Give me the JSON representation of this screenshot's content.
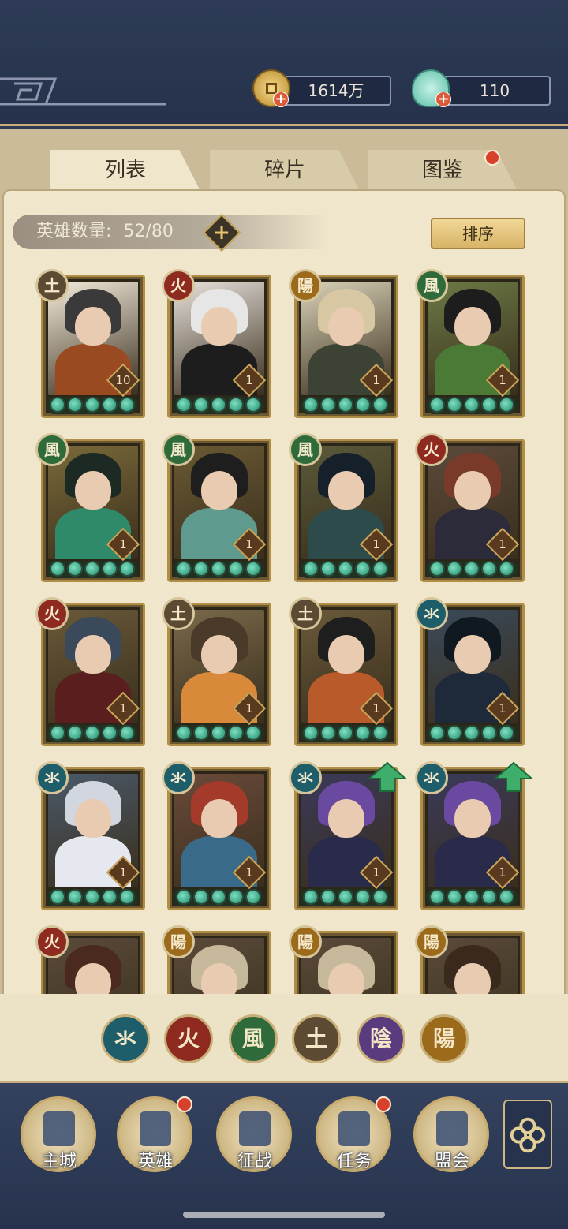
{
  "currency": {
    "coins": "1614万",
    "jade": "110"
  },
  "tabs": [
    {
      "label": "列表",
      "active": true
    },
    {
      "label": "碎片",
      "active": false
    },
    {
      "label": "图鉴",
      "active": false
    }
  ],
  "hero_count": {
    "label": "英雄数量:",
    "value": "52/80"
  },
  "sort_label": "排序",
  "element_glyphs": {
    "water": "氺",
    "fire": "火",
    "wind": "風",
    "earth": "土",
    "yin": "陰",
    "yang": "陽"
  },
  "colors": {
    "water": "#1e5e6a",
    "fire": "#8e2a20",
    "wind": "#2e6a3a",
    "earth": "#5c4a32",
    "yin": "#5a3b7e",
    "yang": "#9b6a1a"
  },
  "heroes": [
    {
      "element": "earth",
      "glyph": "土",
      "level": "10",
      "upgrade": false
    },
    {
      "element": "fire",
      "glyph": "火",
      "level": "1",
      "upgrade": false
    },
    {
      "element": "yang",
      "glyph": "陽",
      "level": "1",
      "upgrade": false
    },
    {
      "element": "wind",
      "glyph": "風",
      "level": "1",
      "upgrade": false
    },
    {
      "element": "wind",
      "glyph": "風",
      "level": "1",
      "upgrade": false
    },
    {
      "element": "wind",
      "glyph": "風",
      "level": "1",
      "upgrade": false
    },
    {
      "element": "wind",
      "glyph": "風",
      "level": "1",
      "upgrade": false
    },
    {
      "element": "fire",
      "glyph": "火",
      "level": "1",
      "upgrade": false
    },
    {
      "element": "fire",
      "glyph": "火",
      "level": "1",
      "upgrade": false
    },
    {
      "element": "earth",
      "glyph": "土",
      "level": "1",
      "upgrade": false
    },
    {
      "element": "earth",
      "glyph": "土",
      "level": "1",
      "upgrade": false
    },
    {
      "element": "water",
      "glyph": "氺",
      "level": "1",
      "upgrade": false
    },
    {
      "element": "water",
      "glyph": "氺",
      "level": "1",
      "upgrade": false
    },
    {
      "element": "water",
      "glyph": "氺",
      "level": "1",
      "upgrade": false
    },
    {
      "element": "water",
      "glyph": "氺",
      "level": "1",
      "upgrade": true
    },
    {
      "element": "water",
      "glyph": "氺",
      "level": "1",
      "upgrade": true
    },
    {
      "element": "fire",
      "glyph": "火",
      "level": "",
      "upgrade": false
    },
    {
      "element": "yang",
      "glyph": "陽",
      "level": "",
      "upgrade": false
    },
    {
      "element": "yang",
      "glyph": "陽",
      "level": "",
      "upgrade": false
    },
    {
      "element": "yang",
      "glyph": "陽",
      "level": "",
      "upgrade": false
    }
  ],
  "filters": [
    {
      "element": "water",
      "glyph": "氺"
    },
    {
      "element": "fire",
      "glyph": "火"
    },
    {
      "element": "wind",
      "glyph": "風"
    },
    {
      "element": "earth",
      "glyph": "土"
    },
    {
      "element": "yin",
      "glyph": "陰"
    },
    {
      "element": "yang",
      "glyph": "陽"
    }
  ],
  "nav": [
    {
      "label": "主城",
      "icon": "castle-icon",
      "dot": false
    },
    {
      "label": "英雄",
      "icon": "hero-icon",
      "dot": true
    },
    {
      "label": "征战",
      "icon": "battle-icon",
      "dot": false
    },
    {
      "label": "任务",
      "icon": "quest-icon",
      "dot": true
    },
    {
      "label": "盟会",
      "icon": "guild-icon",
      "dot": false
    }
  ]
}
